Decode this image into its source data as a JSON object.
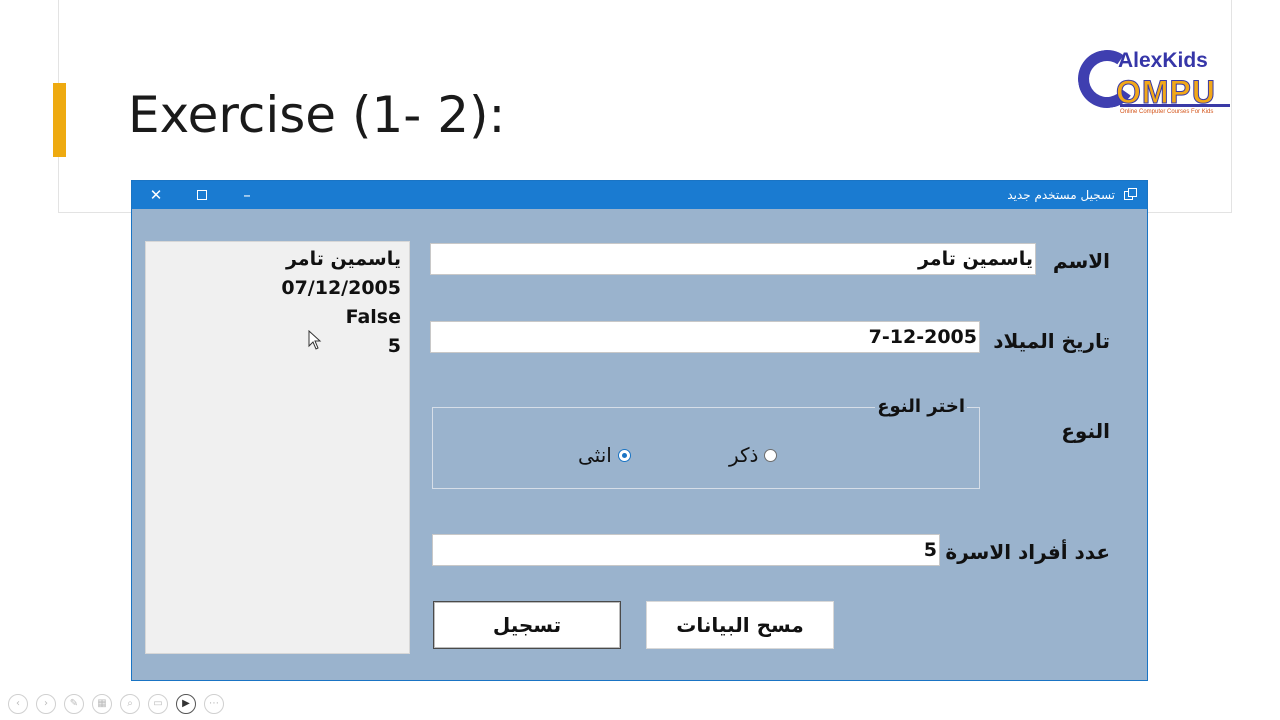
{
  "slide": {
    "title": "Exercise (1- 2):",
    "accent_color": "#eeaa10"
  },
  "logo": {
    "alex": "Alex",
    "kids": "Kids",
    "compu": "OMPU",
    "tagline": "Online Computer Courses For Kids"
  },
  "window": {
    "title": "تسجيل مستخدم جديد",
    "titlebar_color": "#1a7bd1",
    "body_color": "#9ab3cd",
    "controls": {
      "close_icon": "close-icon",
      "maximize_icon": "maximize-icon",
      "minimize_icon": "minimize-icon"
    }
  },
  "form": {
    "name_label": "الاسم",
    "name_value": "ياسمين تامر",
    "birth_label": "تاريخ الميلاد",
    "birth_value": "7-12-2005",
    "gender_label": "النوع",
    "gender_group_title": "اختر النوع",
    "gender_options": [
      {
        "label": "ذكر",
        "checked": false
      },
      {
        "label": "انثى",
        "checked": true
      }
    ],
    "family_label": "عدد أفراد الاسرة",
    "family_value": "5",
    "register_button": "تسجيل",
    "clear_button": "مسح البيانات"
  },
  "output": {
    "lines": [
      "ياسمين تامر",
      "07/12/2005",
      "False",
      "5"
    ]
  }
}
